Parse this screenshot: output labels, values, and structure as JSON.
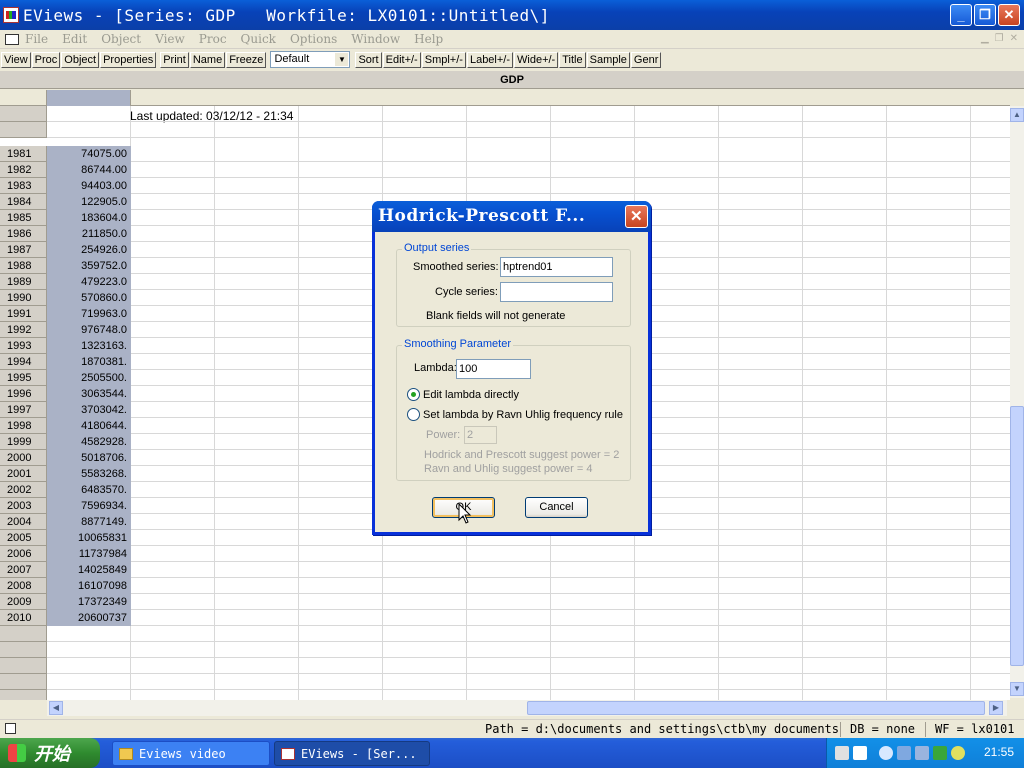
{
  "window": {
    "title": "EViews - [Series: GDP   Workfile: LX0101::Untitled\\]",
    "buttons": {
      "minimize": "_",
      "maximize": "❐",
      "close": "✕"
    }
  },
  "menu": [
    "File",
    "Edit",
    "Object",
    "View",
    "Proc",
    "Quick",
    "Options",
    "Window",
    "Help"
  ],
  "toolbar": {
    "buttons_left": [
      "View",
      "Proc",
      "Object",
      "Properties",
      "Print",
      "Name",
      "Freeze"
    ],
    "select_value": "Default",
    "buttons_right": [
      "Sort",
      "Edit+/-",
      "Smpl+/-",
      "Label+/-",
      "Wide+/-",
      "Title",
      "Sample",
      "Genr"
    ]
  },
  "series": {
    "title": "GDP",
    "last_updated": "Last updated: 03/12/12 - 21:34",
    "rows": [
      {
        "year": "1981",
        "value": "74075.00"
      },
      {
        "year": "1982",
        "value": "86744.00"
      },
      {
        "year": "1983",
        "value": "94403.00"
      },
      {
        "year": "1984",
        "value": "122905.0"
      },
      {
        "year": "1985",
        "value": "183604.0"
      },
      {
        "year": "1986",
        "value": "211850.0"
      },
      {
        "year": "1987",
        "value": "254926.0"
      },
      {
        "year": "1988",
        "value": "359752.0"
      },
      {
        "year": "1989",
        "value": "479223.0"
      },
      {
        "year": "1990",
        "value": "570860.0"
      },
      {
        "year": "1991",
        "value": "719963.0"
      },
      {
        "year": "1992",
        "value": "976748.0"
      },
      {
        "year": "1993",
        "value": "1323163."
      },
      {
        "year": "1994",
        "value": "1870381."
      },
      {
        "year": "1995",
        "value": "2505500."
      },
      {
        "year": "1996",
        "value": "3063544."
      },
      {
        "year": "1997",
        "value": "3703042."
      },
      {
        "year": "1998",
        "value": "4180644."
      },
      {
        "year": "1999",
        "value": "4582928."
      },
      {
        "year": "2000",
        "value": "5018706."
      },
      {
        "year": "2001",
        "value": "5583268."
      },
      {
        "year": "2002",
        "value": "6483570."
      },
      {
        "year": "2003",
        "value": "7596934."
      },
      {
        "year": "2004",
        "value": "8877149."
      },
      {
        "year": "2005",
        "value": "10065831"
      },
      {
        "year": "2006",
        "value": "11737984"
      },
      {
        "year": "2007",
        "value": "14025849"
      },
      {
        "year": "2008",
        "value": "16107098"
      },
      {
        "year": "2009",
        "value": "17372349"
      },
      {
        "year": "2010",
        "value": "20600737"
      }
    ]
  },
  "dialog": {
    "title": "Hodrick-Prescott F...",
    "close": "✕",
    "output_group": "Output series",
    "smoothed_label": "Smoothed series:",
    "smoothed_value": "hptrend01",
    "cycle_label": "Cycle series:",
    "cycle_value": "",
    "blank_note": "Blank fields will not generate",
    "smoothing_group": "Smoothing Parameter",
    "lambda_label": "Lambda:",
    "lambda_value": "100",
    "radio_edit": "Edit lambda directly",
    "radio_ravn": "Set lambda by Ravn Uhlig frequency rule",
    "power_label": "Power:",
    "power_value": "2",
    "hint_hp": "Hodrick and Prescott suggest power = 2",
    "hint_ru": "Ravn and Uhlig suggest power = 4",
    "ok": "OK",
    "cancel": "Cancel",
    "selected_radio": "edit"
  },
  "status": {
    "path": "Path = d:\\documents and settings\\ctb\\my documents",
    "db": "DB = none",
    "wf": "WF = lx0101"
  },
  "taskbar": {
    "start": "开始",
    "tasks": [
      "Eviews video",
      "EViews - [Ser..."
    ],
    "clock": "21:55"
  }
}
